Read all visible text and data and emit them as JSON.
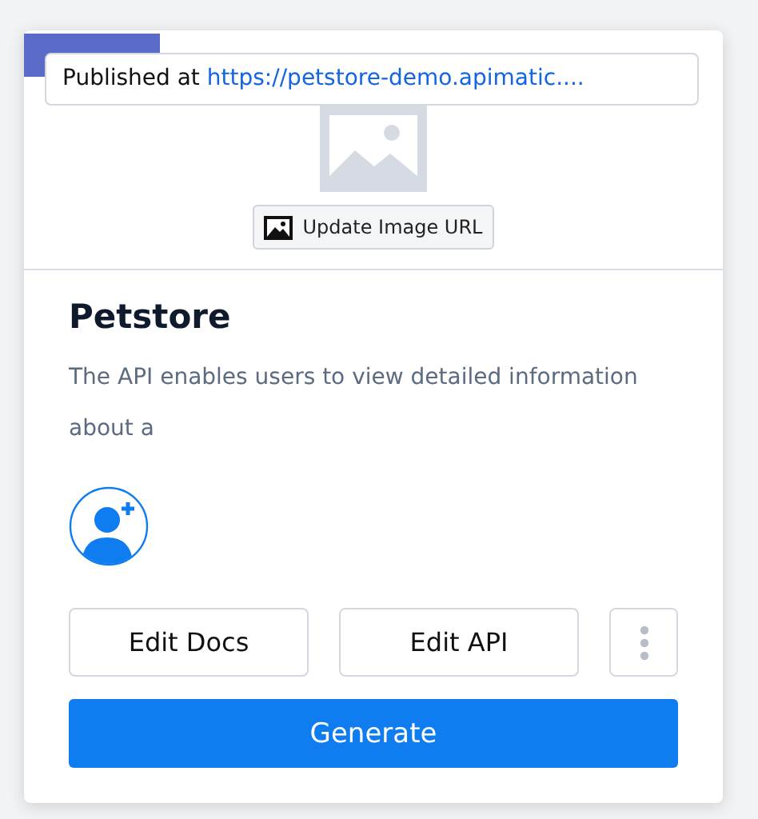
{
  "card": {
    "tooltip": {
      "prefix": "Published at",
      "link": "https://petstore-demo.apimatic...."
    },
    "update_image_button": "Update Image URL",
    "title": "Petstore",
    "description": "The API enables users to view detailed information about a",
    "actions": [
      {
        "label": "Edit Docs",
        "kind": "outline"
      },
      {
        "label": "Edit API",
        "kind": "outline"
      },
      {
        "kind": "more"
      }
    ],
    "primary_button": "Generate"
  }
}
